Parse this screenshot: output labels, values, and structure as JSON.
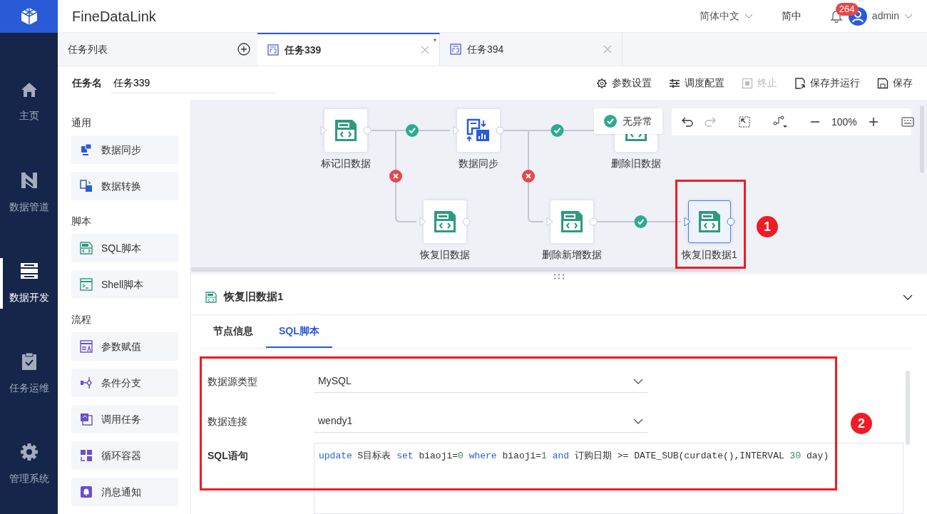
{
  "brand": {
    "name": "FineDataLink"
  },
  "nav": [
    {
      "label": "主页",
      "selected": false
    },
    {
      "label": "数据管道",
      "selected": false
    },
    {
      "label": "数据开发",
      "selected": true
    },
    {
      "label": "任务运维",
      "selected": false
    },
    {
      "label": "管理系统",
      "selected": false
    }
  ],
  "header": {
    "language": "简体中文",
    "short_language": "简中",
    "notifications": "264",
    "user": "admin"
  },
  "task_list_tab": {
    "label": "任务列表"
  },
  "tabs": [
    {
      "label": "任务339",
      "selected": true,
      "modified_mark": "*"
    },
    {
      "label": "任务394",
      "selected": false
    }
  ],
  "task_name": {
    "label": "任务名",
    "value": "任务339"
  },
  "actions": [
    {
      "label": "参数设置",
      "disabled": false
    },
    {
      "label": "调度配置",
      "disabled": false
    },
    {
      "label": "终止",
      "disabled": true
    },
    {
      "label": "保存并运行",
      "disabled": false
    },
    {
      "label": "保存",
      "disabled": false
    }
  ],
  "palette": [
    {
      "heading": "通用",
      "items": [
        {
          "label": "数据同步"
        },
        {
          "label": "数据转换"
        }
      ]
    },
    {
      "heading": "脚本",
      "items": [
        {
          "label": "SQL脚本"
        },
        {
          "label": "Shell脚本"
        }
      ]
    },
    {
      "heading": "流程",
      "items": [
        {
          "label": "参数赋值"
        },
        {
          "label": "条件分支"
        },
        {
          "label": "调用任务"
        },
        {
          "label": "循环容器"
        },
        {
          "label": "消息通知"
        }
      ]
    }
  ],
  "canvas": {
    "status": "无异常",
    "zoom": "100%",
    "nodes": [
      {
        "label": "标记旧数据",
        "kind": "sql",
        "selected": false
      },
      {
        "label": "数据同步",
        "kind": "sync",
        "selected": false
      },
      {
        "label": "删除旧数据",
        "kind": "sql",
        "selected": false
      },
      {
        "label": "恢复旧数据",
        "kind": "sql",
        "selected": false
      },
      {
        "label": "删除新增数据",
        "kind": "sql",
        "selected": false
      },
      {
        "label": "恢复旧数据1",
        "kind": "sql",
        "selected": true
      }
    ],
    "edges": [
      {
        "kind": "success"
      },
      {
        "kind": "fail"
      },
      {
        "kind": "success"
      },
      {
        "kind": "fail"
      },
      {
        "kind": "success"
      }
    ]
  },
  "detail": {
    "title": "恢复旧数据1",
    "tabs": [
      {
        "label": "节点信息",
        "selected": false
      },
      {
        "label": "SQL脚本",
        "selected": true
      }
    ],
    "fields": [
      {
        "label": "数据源类型",
        "value": "MySQL"
      },
      {
        "label": "数据连接",
        "value": "wendy1"
      }
    ],
    "sql_label": "SQL语句",
    "sql": [
      {
        "kind": "keyword",
        "text": "update"
      },
      {
        "kind": "plain",
        "text": " S目标表 "
      },
      {
        "kind": "keyword",
        "text": "set"
      },
      {
        "kind": "plain",
        "text": " biaoji="
      },
      {
        "kind": "number",
        "text": "0"
      },
      {
        "kind": "keyword",
        "text": " where"
      },
      {
        "kind": "plain",
        "text": " biaoji="
      },
      {
        "kind": "number",
        "text": "1"
      },
      {
        "kind": "keyword",
        "text": " and"
      },
      {
        "kind": "plain",
        "text": " 订购日期 >= DATE_SUB(curdate(),INTERVAL "
      },
      {
        "kind": "number",
        "text": "30"
      },
      {
        "kind": "plain",
        "text": " day)"
      }
    ]
  },
  "annotations": [
    {
      "label": "1"
    },
    {
      "label": "2"
    }
  ]
}
